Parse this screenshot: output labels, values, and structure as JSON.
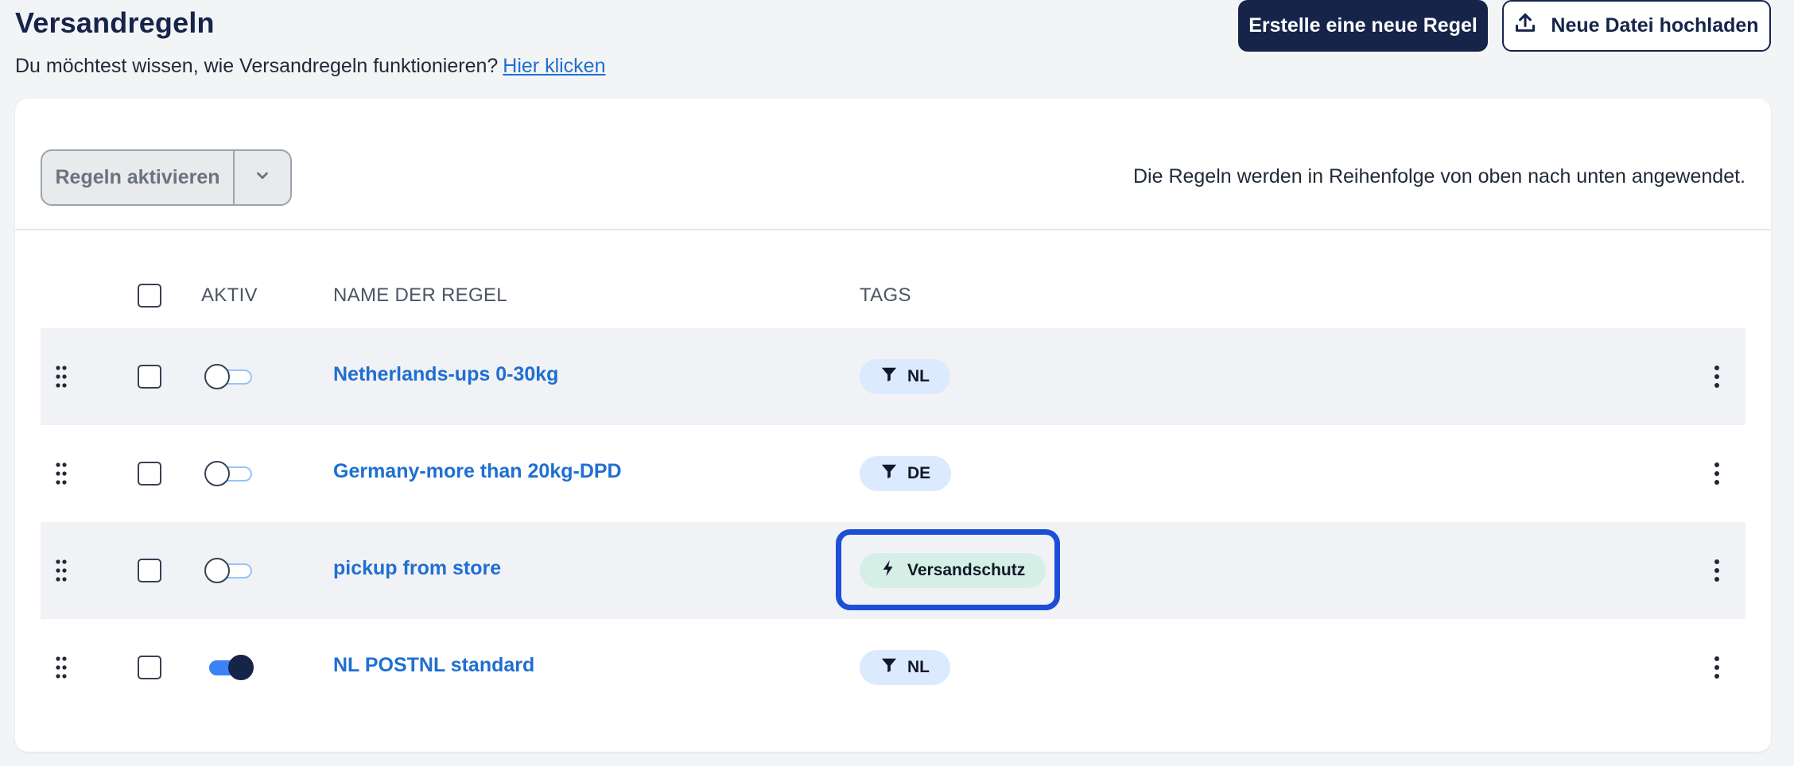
{
  "header": {
    "title": "Versandregeln",
    "subtitle": "Du möchtest wissen, wie Versandregeln funktionieren?",
    "help_link": "Hier klicken",
    "create_button": "Erstelle eine neue Regel",
    "upload_button": "Neue Datei hochladen"
  },
  "toolbar": {
    "activate_button": "Regeln aktivieren",
    "info_text": "Die Regeln werden in Reihenfolge von oben nach unten angewendet."
  },
  "table": {
    "columns": {
      "active": "AKTIV",
      "name": "NAME DER REGEL",
      "tags": "TAGS"
    },
    "rows": [
      {
        "name": "Netherlands-ups 0-30kg",
        "active": false,
        "tag": "NL",
        "tag_icon": "filter-icon"
      },
      {
        "name": "Germany-more than 20kg-DPD",
        "active": false,
        "tag": "DE",
        "tag_icon": "filter-icon"
      },
      {
        "name": "pickup from store",
        "active": false,
        "tag": "Versandschutz",
        "tag_icon": "bolt-icon"
      },
      {
        "name": "NL POSTNL standard",
        "active": true,
        "tag": "NL",
        "tag_icon": "filter-icon"
      }
    ]
  },
  "colors": {
    "primary": "#16244a",
    "link": "#1f6fd1",
    "tag_blue": "#dbeafe",
    "tag_green": "#d6efe6",
    "highlight": "#1d4ed8"
  }
}
